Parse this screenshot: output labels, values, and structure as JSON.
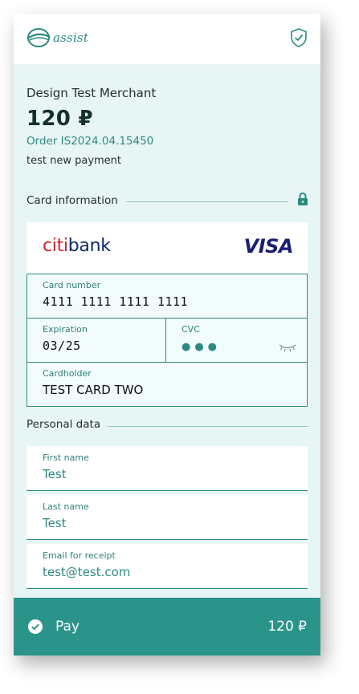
{
  "header": {
    "logo_text": "assist",
    "logo_icon": "assist-logo-icon",
    "shield_icon": "shield-check-icon"
  },
  "order": {
    "merchant": "Design Test Merchant",
    "amount": "120 ₽",
    "order_number": "Order IS2024.04.15450",
    "description": "test new payment"
  },
  "card_section": {
    "title": "Card information",
    "lock_icon": "lock-icon",
    "bank_name_prefix": "citi",
    "bank_name_suffix": "bank",
    "network": "VISA",
    "card_number_label": "Card number",
    "card_number": "4111 1111 1111 1111",
    "expiration_label": "Expiration",
    "expiration": "03/25",
    "cvc_label": "CVC",
    "cvc_masked": "●●●",
    "cvc_toggle_icon": "eye-closed-icon",
    "cardholder_label": "Cardholder",
    "cardholder": "TEST CARD TWO"
  },
  "personal_section": {
    "title": "Personal data",
    "fields": [
      {
        "label": "First name",
        "value": "Test"
      },
      {
        "label": "Last name",
        "value": "Test"
      },
      {
        "label": "Email for receipt",
        "value": "test@test.com"
      }
    ]
  },
  "pay": {
    "label": "Pay",
    "amount": "120 ₽",
    "icon": "check-circle-icon"
  },
  "colors": {
    "accent": "#2a948a",
    "panel_bg": "#e8f5f5",
    "field_border": "#2e8a80",
    "citi_blue": "#0b2a6e",
    "citi_red": "#d3212c",
    "visa_blue": "#1a1f71"
  }
}
